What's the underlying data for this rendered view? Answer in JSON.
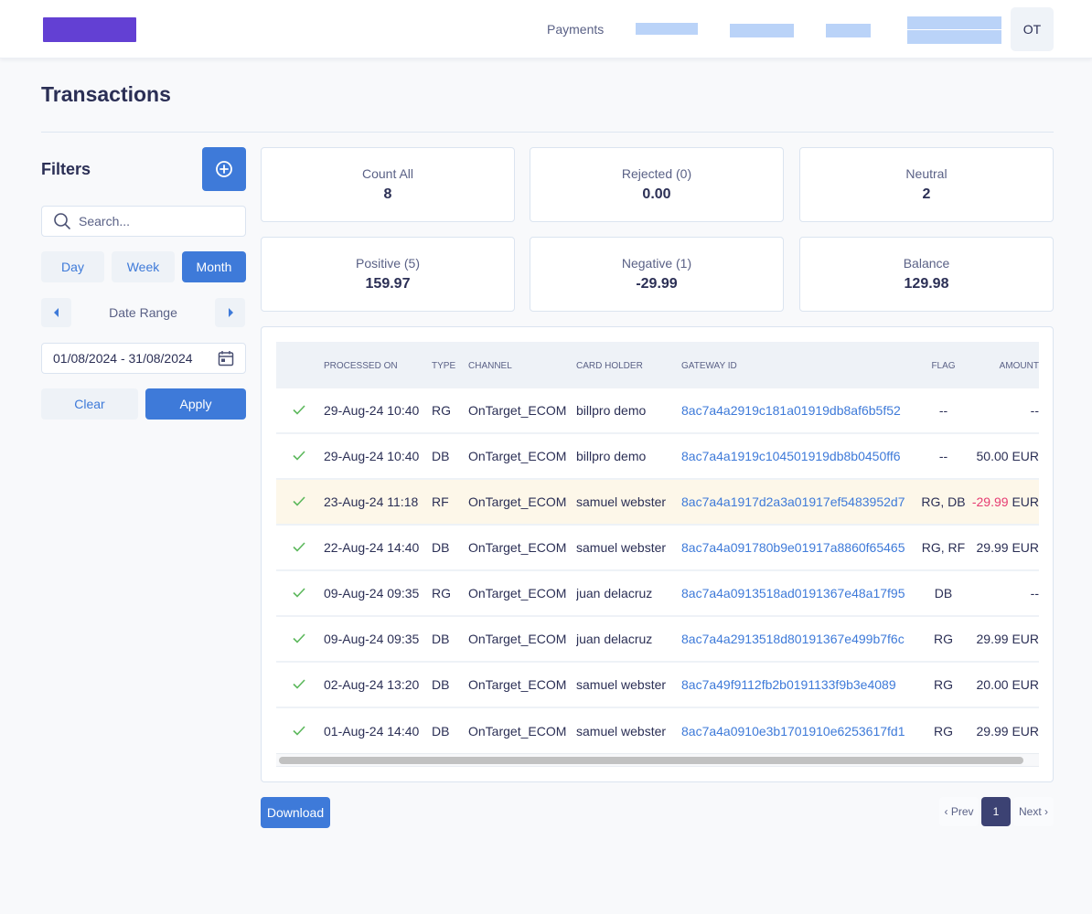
{
  "header": {
    "nav_link": "Payments",
    "avatar_initials": "OT"
  },
  "page": {
    "title": "Transactions"
  },
  "filters": {
    "title": "Filters",
    "add_icon": "plus-circle-icon",
    "search": {
      "placeholder": "Search...",
      "value": ""
    },
    "periods": [
      "Day",
      "Week",
      "Month"
    ],
    "active_period": "Month",
    "range_label": "Date Range",
    "date_range_value": "01/08/2024 - 31/08/2024",
    "clear_label": "Clear",
    "apply_label": "Apply"
  },
  "stats": [
    {
      "label": "Count All",
      "value": "8"
    },
    {
      "label": "Rejected (0)",
      "value": "0.00"
    },
    {
      "label": "Neutral",
      "value": "2"
    },
    {
      "label": "Positive (5)",
      "value": "159.97"
    },
    {
      "label": "Negative (1)",
      "value": "-29.99"
    },
    {
      "label": "Balance",
      "value": "129.98"
    }
  ],
  "table": {
    "columns": [
      "",
      "Processed On",
      "Type",
      "Channel",
      "Card Holder",
      "Gateway ID",
      "Flag",
      "Amount"
    ],
    "rows": [
      {
        "status": "success",
        "processed_on": "29-Aug-24 10:40",
        "type": "RG",
        "channel": "OnTarget_ECOM",
        "card_holder": "billpro demo",
        "gateway_id": "8ac7a4a2919c181a01919db8af6b5f52",
        "flag": "--",
        "amount": "--",
        "currency": "",
        "negative": false,
        "highlight": false
      },
      {
        "status": "success",
        "processed_on": "29-Aug-24 10:40",
        "type": "DB",
        "channel": "OnTarget_ECOM",
        "card_holder": "billpro demo",
        "gateway_id": "8ac7a4a1919c104501919db8b0450ff6",
        "flag": "--",
        "amount": "50.00",
        "currency": "EUR",
        "negative": false,
        "highlight": false
      },
      {
        "status": "success",
        "processed_on": "23-Aug-24 11:18",
        "type": "RF",
        "channel": "OnTarget_ECOM",
        "card_holder": "samuel webster",
        "gateway_id": "8ac7a4a1917d2a3a01917ef5483952d7",
        "flag": "RG, DB",
        "amount": "-29.99",
        "currency": "EUR",
        "negative": true,
        "highlight": true
      },
      {
        "status": "success",
        "processed_on": "22-Aug-24 14:40",
        "type": "DB",
        "channel": "OnTarget_ECOM",
        "card_holder": "samuel webster",
        "gateway_id": "8ac7a4a091780b9e01917a8860f65465",
        "flag": "RG, RF",
        "amount": "29.99",
        "currency": "EUR",
        "negative": false,
        "highlight": false
      },
      {
        "status": "success",
        "processed_on": "09-Aug-24 09:35",
        "type": "RG",
        "channel": "OnTarget_ECOM",
        "card_holder": "juan delacruz",
        "gateway_id": "8ac7a4a0913518ad0191367e48a17f95",
        "flag": "DB",
        "amount": "--",
        "currency": "",
        "negative": false,
        "highlight": false
      },
      {
        "status": "success",
        "processed_on": "09-Aug-24 09:35",
        "type": "DB",
        "channel": "OnTarget_ECOM",
        "card_holder": "juan delacruz",
        "gateway_id": "8ac7a4a2913518d80191367e499b7f6c",
        "flag": "RG",
        "amount": "29.99",
        "currency": "EUR",
        "negative": false,
        "highlight": false
      },
      {
        "status": "success",
        "processed_on": "02-Aug-24 13:20",
        "type": "DB",
        "channel": "OnTarget_ECOM",
        "card_holder": "samuel webster",
        "gateway_id": "8ac7a49f9112fb2b0191133f9b3e4089",
        "flag": "RG",
        "amount": "20.00",
        "currency": "EUR",
        "negative": false,
        "highlight": false
      },
      {
        "status": "success",
        "processed_on": "01-Aug-24 14:40",
        "type": "DB",
        "channel": "OnTarget_ECOM",
        "card_holder": "samuel webster",
        "gateway_id": "8ac7a4a0910e3b1701910e6253617fd1",
        "flag": "RG",
        "amount": "29.99",
        "currency": "EUR",
        "negative": false,
        "highlight": false
      }
    ]
  },
  "footer": {
    "download_label": "Download",
    "pagination": {
      "prev_label": "‹ Prev",
      "current_page": "1",
      "next_label": "Next ›"
    }
  },
  "colors": {
    "brand": "#6340d3",
    "accent": "#3e7ad9",
    "success": "#5cb85c",
    "negative": "#e63c72",
    "highlight_row": "#fdf7e9"
  }
}
